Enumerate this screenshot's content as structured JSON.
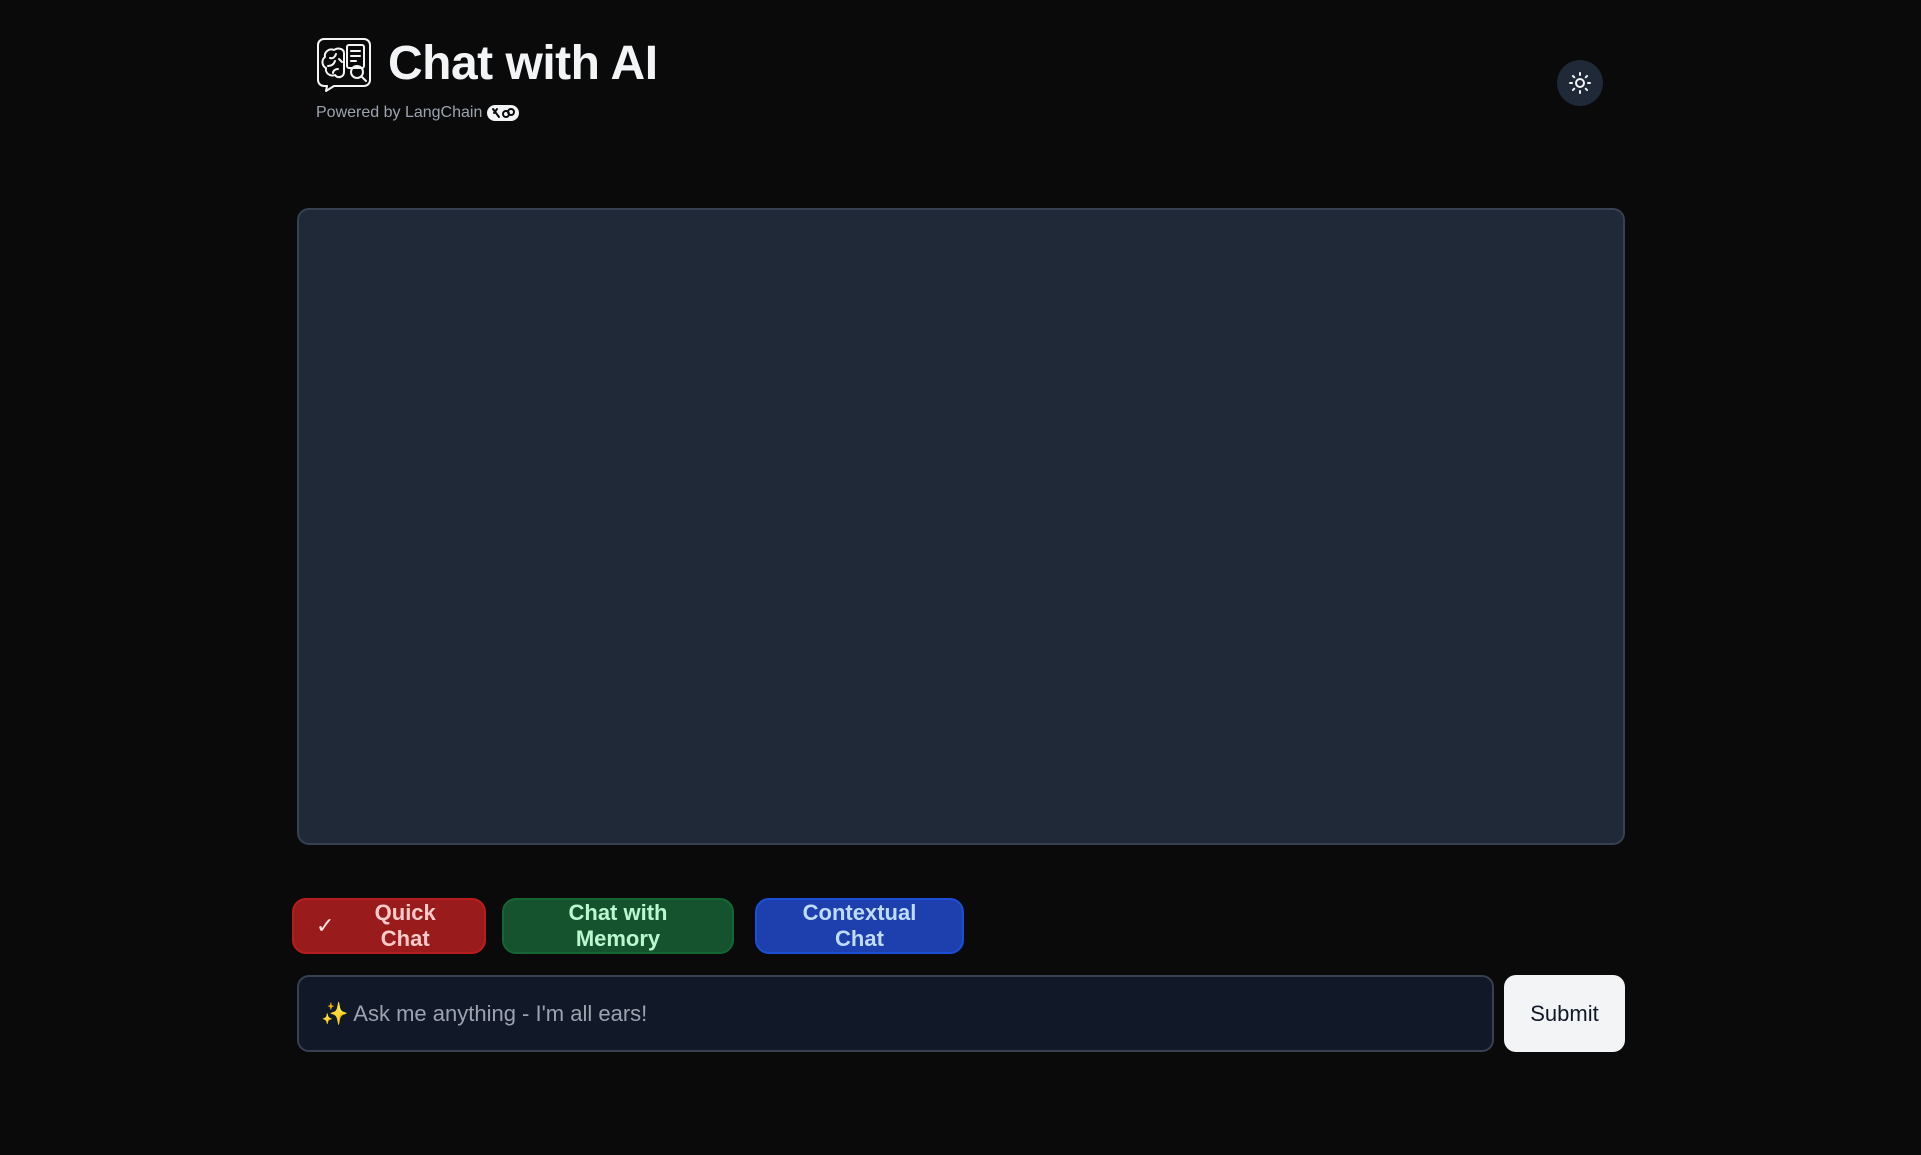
{
  "header": {
    "title": "Chat with AI",
    "subtitle": "Powered by LangChain",
    "app_icon": "brain-document-chat-icon",
    "langchain_icon": "langchain-logo-icon"
  },
  "theme_toggle": {
    "icon": "sun-icon"
  },
  "chat_modes": {
    "items": [
      {
        "label": "Quick Chat",
        "selected": true,
        "color": "#991b1b"
      },
      {
        "label": "Chat with Memory",
        "selected": false,
        "color": "#14532d"
      },
      {
        "label": "Contextual Chat",
        "selected": false,
        "color": "#1e40af"
      }
    ],
    "check_glyph": "✓"
  },
  "input": {
    "placeholder": "✨ Ask me anything - I'm all ears!",
    "value": ""
  },
  "submit_label": "Submit",
  "colors": {
    "background": "#0a0a0b",
    "panel": "#1f2937",
    "input_bg": "#111827"
  }
}
